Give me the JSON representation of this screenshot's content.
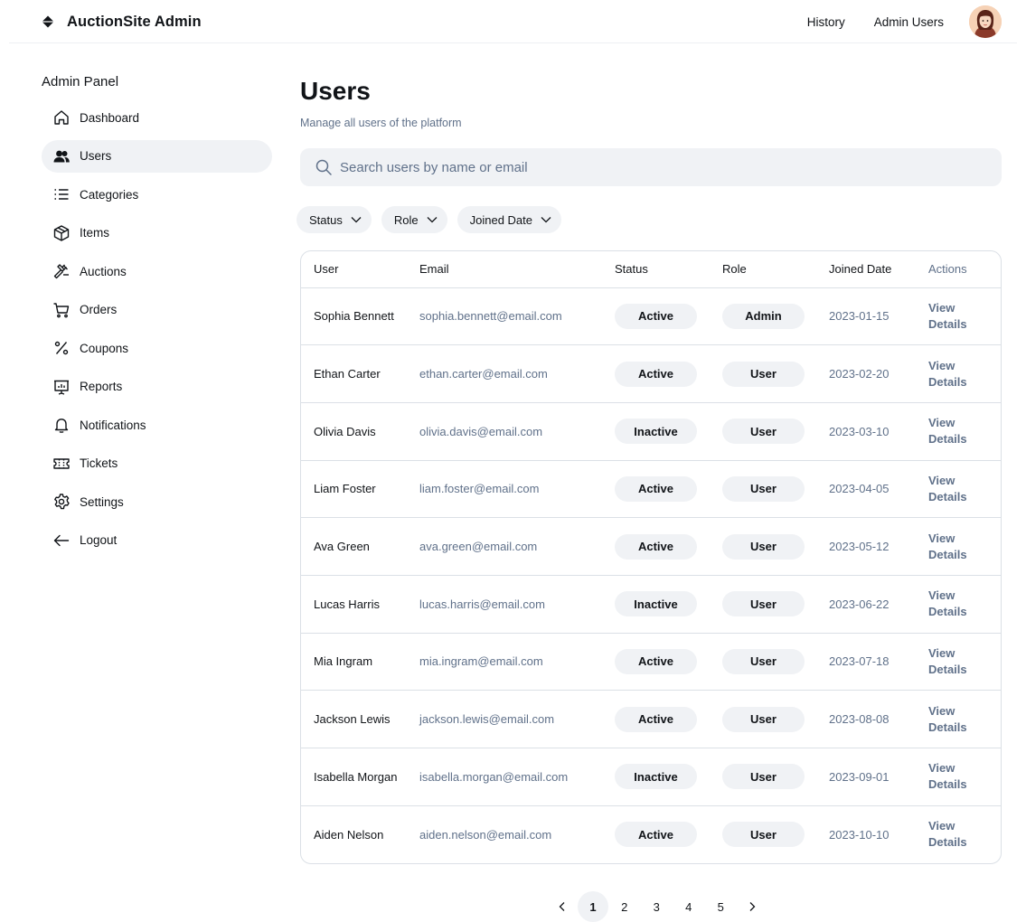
{
  "header": {
    "brand_name": "AuctionSite Admin",
    "nav": [
      "History",
      "Admin Users"
    ],
    "avatar_icon": "user-avatar"
  },
  "sidebar": {
    "title": "Admin Panel",
    "items": [
      {
        "label": "Dashboard",
        "icon": "home-icon"
      },
      {
        "label": "Users",
        "icon": "users-icon",
        "active": true
      },
      {
        "label": "Categories",
        "icon": "list-icon"
      },
      {
        "label": "Items",
        "icon": "package-icon"
      },
      {
        "label": "Auctions",
        "icon": "gavel-icon"
      },
      {
        "label": "Orders",
        "icon": "cart-icon"
      },
      {
        "label": "Coupons",
        "icon": "percent-icon"
      },
      {
        "label": "Reports",
        "icon": "presentation-chart-icon"
      },
      {
        "label": "Notifications",
        "icon": "bell-icon"
      },
      {
        "label": "Tickets",
        "icon": "ticket-icon"
      },
      {
        "label": "Settings",
        "icon": "gear-icon"
      },
      {
        "label": "Logout",
        "icon": "arrow-left-icon"
      }
    ]
  },
  "main": {
    "title": "Users",
    "subtitle": "Manage all users of the platform",
    "search_placeholder": "Search users by name or email",
    "filters": [
      "Status",
      "Role",
      "Joined Date"
    ],
    "table": {
      "headers": [
        "User",
        "Email",
        "Status",
        "Role",
        "Joined Date",
        "Actions"
      ],
      "action_label_1": "View",
      "action_label_2": "Details",
      "rows": [
        {
          "name": "Sophia Bennett",
          "email": "sophia.bennett@email.com",
          "status": "Active",
          "role": "Admin",
          "joined": "2023-01-15"
        },
        {
          "name": "Ethan Carter",
          "email": "ethan.carter@email.com",
          "status": "Active",
          "role": "User",
          "joined": "2023-02-20"
        },
        {
          "name": "Olivia Davis",
          "email": "olivia.davis@email.com",
          "status": "Inactive",
          "role": "User",
          "joined": "2023-03-10"
        },
        {
          "name": "Liam Foster",
          "email": "liam.foster@email.com",
          "status": "Active",
          "role": "User",
          "joined": "2023-04-05"
        },
        {
          "name": "Ava Green",
          "email": "ava.green@email.com",
          "status": "Active",
          "role": "User",
          "joined": "2023-05-12"
        },
        {
          "name": "Lucas Harris",
          "email": "lucas.harris@email.com",
          "status": "Inactive",
          "role": "User",
          "joined": "2023-06-22"
        },
        {
          "name": "Mia Ingram",
          "email": "mia.ingram@email.com",
          "status": "Active",
          "role": "User",
          "joined": "2023-07-18"
        },
        {
          "name": "Jackson Lewis",
          "email": "jackson.lewis@email.com",
          "status": "Active",
          "role": "User",
          "joined": "2023-08-08"
        },
        {
          "name": "Isabella Morgan",
          "email": "isabella.morgan@email.com",
          "status": "Inactive",
          "role": "User",
          "joined": "2023-09-01"
        },
        {
          "name": "Aiden Nelson",
          "email": "aiden.nelson@email.com",
          "status": "Active",
          "role": "User",
          "joined": "2023-10-10"
        }
      ]
    },
    "pagination": {
      "pages": [
        "1",
        "2",
        "3",
        "4",
        "5"
      ],
      "current": "1"
    }
  },
  "colors": {
    "text": "#111418",
    "muted": "#60718a",
    "surface": "#f0f2f5",
    "border": "#dbe0e6"
  }
}
